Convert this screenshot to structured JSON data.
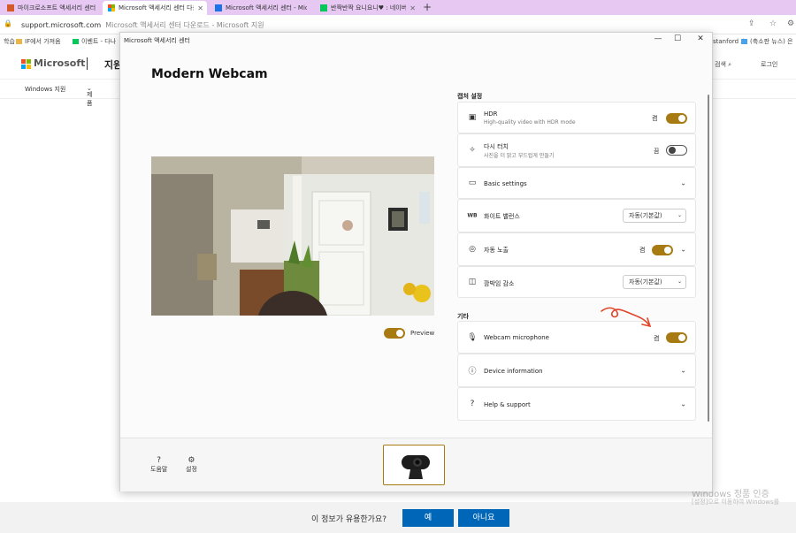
{
  "browser": {
    "tabs": [
      {
        "title": "마이크로소프트 액세서리 센터",
        "active": false,
        "color": "#d45a2a"
      },
      {
        "title": "Microsoft 액세서리 센터 다운로드",
        "active": true,
        "color": "#f25022"
      },
      {
        "title": "Microsoft 액세서리 센터 - Mic",
        "active": false,
        "color": "#1a73e8"
      },
      {
        "title": "반짝반짝 요니요니♥ : 네이버 블",
        "active": false,
        "color": "#03c75a"
      }
    ],
    "new_tab": "+",
    "address": {
      "domain": "support.microsoft.com",
      "page_title": "Microsoft 액세서리 센터 다운로드 - Microsoft 지원"
    },
    "bookmarks": [
      "학습",
      "IF에서 가져옴",
      "이벤트 - 다나",
      "stanford 스",
      "(축소판 뉴스) 은"
    ]
  },
  "site": {
    "brand": "Microsoft",
    "support": "지원",
    "right_items": [
      "검색",
      "로그인"
    ],
    "subnav": [
      "Windows 지원",
      "제품"
    ]
  },
  "app": {
    "window_title": "Microsoft 액세서리 센터",
    "controls": [
      "minimize",
      "maximize",
      "close"
    ],
    "device_name": "Modern Webcam",
    "preview": {
      "label": "Preview",
      "on": true
    },
    "sections": {
      "camera_settings": "캡처 설정",
      "other": "기타"
    },
    "rows": {
      "hdr": {
        "title": "HDR",
        "subtitle": "High-quality video with HDR mode",
        "state": "켬",
        "on": true
      },
      "retouch": {
        "title": "다시 터치",
        "subtitle": "사진을 더 밝고 부드럽게 만들기",
        "state": "끔",
        "on": false
      },
      "basic": {
        "title": "Basic settings"
      },
      "wb": {
        "icon_text": "WB",
        "title": "화이트 밸런스",
        "value": "자동(기본값)"
      },
      "exposure": {
        "title": "자동 노출",
        "state": "켬",
        "on": true
      },
      "flicker": {
        "title": "깜박임 감소",
        "value": "자동(기본값)"
      },
      "mic": {
        "title": "Webcam microphone",
        "state": "켬",
        "on": true
      },
      "device_info": {
        "title": "Device information"
      },
      "help": {
        "title": "Help & support"
      }
    },
    "bottom": {
      "help_label": "도움말",
      "settings_label": "설정"
    }
  },
  "feedback": {
    "question": "이 정보가 유용한가요?",
    "yes": "예",
    "no": "아니요"
  },
  "watermark": {
    "line1": "Windows 정품 인증",
    "line2": "[설정]으로 이동하여 Windows를"
  },
  "colors": {
    "accent": "#a87b12",
    "ms_blue": "#0067b8",
    "annotation": "#e0452a"
  }
}
